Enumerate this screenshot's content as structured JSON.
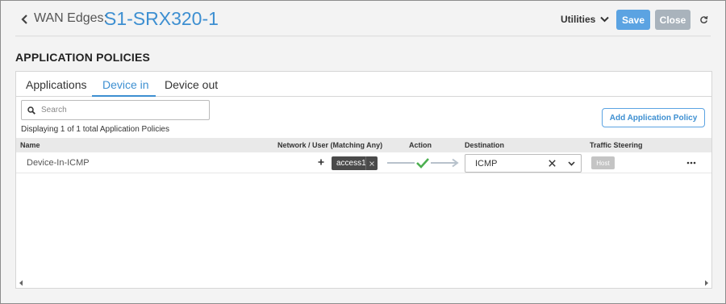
{
  "header": {
    "breadcrumb": "WAN Edges:",
    "title": "S1-SRX320-1",
    "utilities_label": "Utilities",
    "save_label": "Save",
    "close_label": "Close"
  },
  "section": {
    "title": "APPLICATION POLICIES"
  },
  "tabs": [
    {
      "label": "Applications",
      "active": false
    },
    {
      "label": "Device in",
      "active": true
    },
    {
      "label": "Device out",
      "active": false
    }
  ],
  "search": {
    "placeholder": "Search",
    "value": ""
  },
  "summary": "Displaying 1 of 1 total Application Policies",
  "add_button_label": "Add Application Policy",
  "table": {
    "columns": [
      "Name",
      "Network / User (Matching Any)",
      "Action",
      "Destination",
      "Traffic Steering"
    ],
    "rows": [
      {
        "name": "Device-In-ICMP",
        "network_chip": "access1",
        "action": "allow",
        "destination": "ICMP",
        "traffic_steering": "Host"
      }
    ]
  },
  "colors": {
    "accent": "#3d8fd1",
    "save_button": "#5ba3e2",
    "close_button": "#a9b3bc",
    "allow_check": "#4caf50"
  },
  "icons": {
    "back": "chevron-left-icon",
    "utilities": "chevron-down-icon",
    "refresh": "refresh-icon",
    "search": "search-icon",
    "add_network": "plus-icon",
    "remove_chip": "close-icon",
    "action": "check-icon",
    "clear": "clear-icon",
    "dropdown": "chevron-down-icon",
    "row_menu": "more-icon"
  }
}
